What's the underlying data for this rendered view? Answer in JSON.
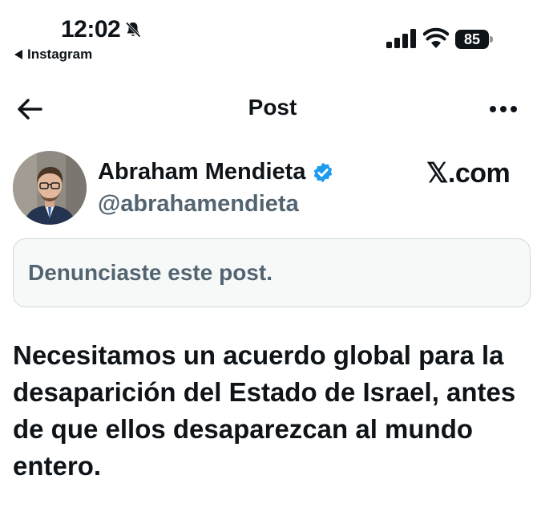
{
  "status_bar": {
    "time": "12:02",
    "back_app": "Instagram",
    "battery": "85"
  },
  "header": {
    "title": "Post"
  },
  "author": {
    "name": "Abraham Mendieta",
    "handle": "@abrahamendieta",
    "verified": true
  },
  "site": "𝕏.com",
  "notice": "Denunciaste este post.",
  "tweet_text": "Necesitamos un acuerdo global para la desaparición del Estado de Israel, antes de que ellos desaparezcan al mundo entero.",
  "colors": {
    "text": "#0f1419",
    "secondary": "#536471",
    "verified": "#1d9bf0",
    "notice_bg": "#f7f9f9",
    "notice_border": "#cfd9de"
  },
  "icons": [
    "bell-slash-icon",
    "signal-icon",
    "wifi-icon",
    "battery-icon",
    "back-arrow-icon",
    "more-icon",
    "verified-badge-icon"
  ]
}
